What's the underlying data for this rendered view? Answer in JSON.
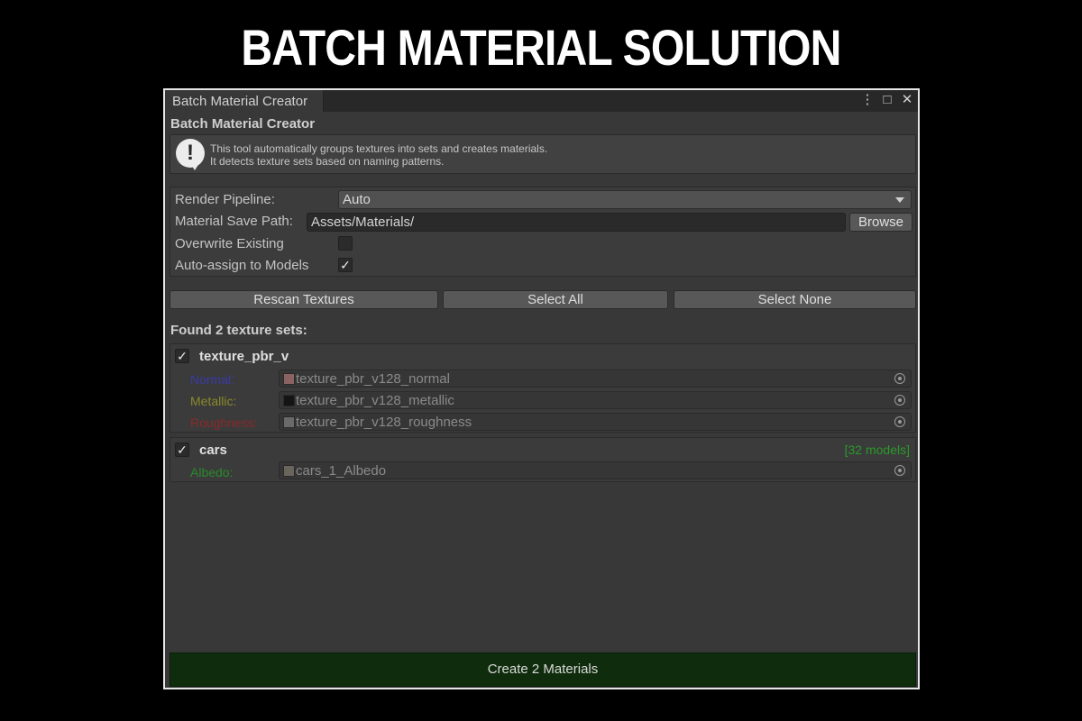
{
  "page_title": "BATCH MATERIAL SOLUTION",
  "window": {
    "tab_label": "Batch Material Creator",
    "controls": {
      "menu": "⋮",
      "maximize": "□",
      "close": "✕"
    }
  },
  "panel": {
    "title": "Batch Material Creator",
    "info_lines": [
      "This tool automatically groups textures into sets and creates materials.",
      "It detects texture sets based on naming patterns."
    ]
  },
  "settings": {
    "render_pipeline_label": "Render Pipeline:",
    "render_pipeline_value": "Auto",
    "save_path_label": "Material Save Path:",
    "save_path_value": "Assets/Materials/",
    "browse_label": "Browse",
    "overwrite_label": "Overwrite Existing",
    "overwrite_checked": false,
    "auto_assign_label": "Auto-assign to Models",
    "auto_assign_checked": true
  },
  "actions": {
    "rescan": "Rescan Textures",
    "select_all": "Select All",
    "select_none": "Select None"
  },
  "found_label": "Found 2 texture sets:",
  "texture_sets": [
    {
      "name": "texture_pbr_v",
      "checked": true,
      "models": "",
      "maps": [
        {
          "label": "Normal:",
          "label_color": "#3a3aa8",
          "file": "texture_pbr_v128_normal",
          "swatch": "#8a6262"
        },
        {
          "label": "Metallic:",
          "label_color": "#8a8a2a",
          "file": "texture_pbr_v128_metallic",
          "swatch": "#141414"
        },
        {
          "label": "Roughness:",
          "label_color": "#8a2a2a",
          "file": "texture_pbr_v128_roughness",
          "swatch": "#6a6a6a"
        }
      ]
    },
    {
      "name": "cars",
      "checked": true,
      "models": "[32 models]",
      "maps": [
        {
          "label": "Albedo:",
          "label_color": "#2a8a2a",
          "file": "cars_1_Albedo",
          "swatch": "#6a655c"
        }
      ]
    }
  ],
  "create_button": "Create 2 Materials"
}
